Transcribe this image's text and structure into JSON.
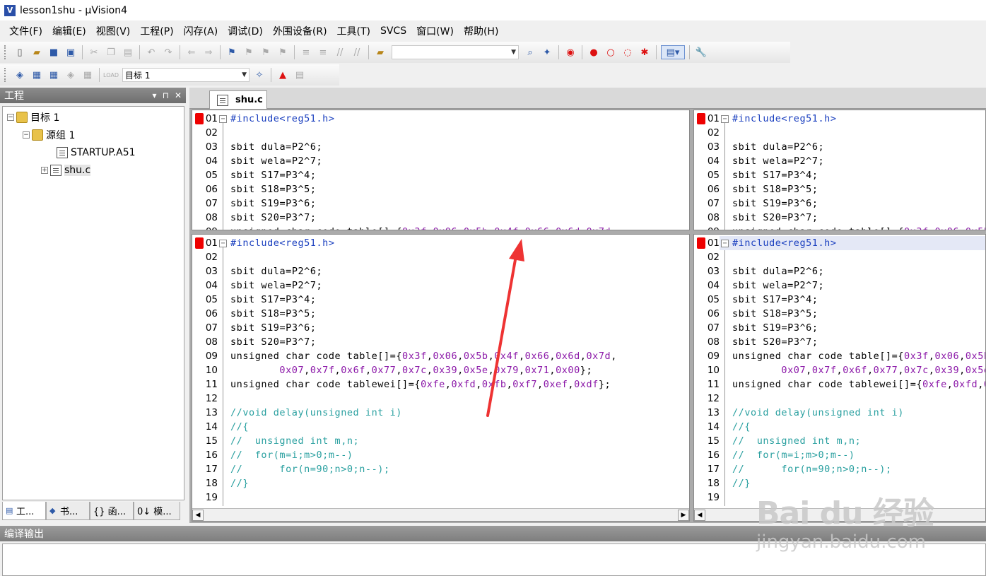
{
  "window": {
    "title": "lesson1shu  - μVision4",
    "app_icon_letter": "V"
  },
  "menu": [
    "文件(F)",
    "编辑(E)",
    "视图(V)",
    "工程(P)",
    "闪存(A)",
    "调试(D)",
    "外围设备(R)",
    "工具(T)",
    "SVCS",
    "窗口(W)",
    "帮助(H)"
  ],
  "toolbar2": {
    "target_value": "目标 1"
  },
  "project": {
    "header": "工程",
    "tree": {
      "target": "目标 1",
      "group": "源组 1",
      "file1": "STARTUP.A51",
      "file2": "shu.c"
    },
    "tabs": [
      "工...",
      "书...",
      "{} 函...",
      "0↓ 模..."
    ]
  },
  "editor": {
    "tab": "shu.c",
    "line_numbers": [
      "01",
      "02",
      "03",
      "04",
      "05",
      "06",
      "07",
      "08",
      "09",
      "10",
      "11",
      "12",
      "13",
      "14",
      "15",
      "16",
      "17",
      "18",
      "19"
    ],
    "code": [
      "#include<reg51.h>",
      "",
      "sbit dula=P2^6;",
      "sbit wela=P2^7;",
      "sbit S17=P3^4;",
      "sbit S18=P3^5;",
      "sbit S19=P3^6;",
      "sbit S20=P3^7;",
      "unsigned char code table[]={0x3f,0x06,0x5b,0x4f,0x66,0x6d,0x7d,",
      "        0x07,0x7f,0x6f,0x77,0x7c,0x39,0x5e,0x79,0x71,0x00};",
      "unsigned char code tablewei[]={0xfe,0xfd,0xfb,0xf7,0xef,0xdf};",
      "",
      "//void delay(unsigned int i)",
      "//{",
      "//  unsigned int m,n;",
      "//  for(m=i;m>0;m--)",
      "//      for(n=90;n>0;n--);",
      "//}",
      ""
    ]
  },
  "build_output": {
    "header": "编译输出"
  },
  "watermark": {
    "brand": "Bai du 经验",
    "url": "jingyan.baidu.com"
  },
  "colors": {
    "preprocessor": "#1a3fbf",
    "hex": "#8b18a8",
    "comment": "#2aa0a0",
    "bookmark": "#e00000",
    "annotation_arrow": "#ee3333"
  }
}
